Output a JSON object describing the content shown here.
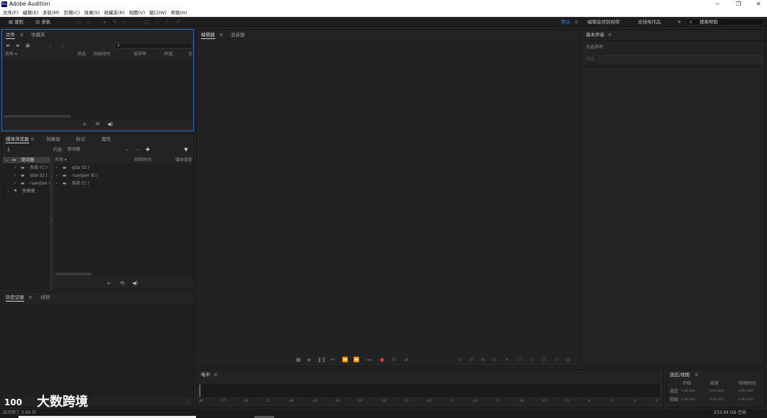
{
  "window": {
    "title": "Adobe Audition",
    "logo": "Au"
  },
  "menu": [
    "文件(F)",
    "编辑(E)",
    "多轨(M)",
    "剪辑(C)",
    "效果(S)",
    "收藏夹(R)",
    "视图(V)",
    "窗口(W)",
    "帮助(H)"
  ],
  "toolbar": {
    "waveform": "波形",
    "multitrack": "多轨",
    "workspaces": [
      "默认",
      "编辑音频到视频",
      "无线电作品"
    ],
    "more": "»",
    "search_placeholder": "搜索帮助"
  },
  "files_panel": {
    "tabs": [
      "文件",
      "收藏夹"
    ],
    "columns": [
      "名称 ▾",
      "状态",
      "持续时间",
      "采样率",
      "声道",
      "位"
    ]
  },
  "media_browser": {
    "tabs": [
      "媒体浏览器",
      "效果组",
      "标记",
      "属性"
    ],
    "content_label": "内容:",
    "content_value": "驱动器",
    "tree": [
      "驱动器",
      "系统 (C:)",
      "qita (D:)",
      "ruanjian (E:)",
      "快捷键"
    ],
    "columns": [
      "名称 ▾",
      "持续时间",
      "媒体类型"
    ],
    "files": [
      "qita (D:)",
      "ruanjian (E:)",
      "系统 (C:)"
    ]
  },
  "history_panel": {
    "tabs": [
      "历史记录",
      "视频"
    ],
    "status": "启动用了 3.84 秒"
  },
  "editor": {
    "tabs": [
      "编辑器",
      "混音器"
    ]
  },
  "essential_sound": {
    "title": "基本声音",
    "no_selection": "无选择项",
    "preset_label": "预设:"
  },
  "levels": {
    "title": "电平",
    "ticks": [
      "dB",
      "-57",
      "-54",
      "-51",
      "-48",
      "-45",
      "-42",
      "-39",
      "-36",
      "-33",
      "-30",
      "-27",
      "-24",
      "-21",
      "-18",
      "-15",
      "-12",
      "-9",
      "-6",
      "-3",
      "0"
    ]
  },
  "selection_view": {
    "title": "选区/视图",
    "columns": [
      "开始",
      "结束",
      "持续时间"
    ],
    "rows": [
      {
        "label": "选区",
        "values": [
          "0:00.000",
          "0:00.000",
          "0:00.000"
        ]
      },
      {
        "label": "视图",
        "values": [
          "0:00.000",
          "0:00.000",
          "0:00.000"
        ]
      }
    ]
  },
  "statusbar": {
    "disk": "233.94 GB 空闲"
  },
  "watermark": {
    "text": "大数跨境",
    "logo": "100"
  },
  "colors": {
    "accent": "#2d8ceb",
    "record": "#e03b3b",
    "bg": "#232323"
  }
}
